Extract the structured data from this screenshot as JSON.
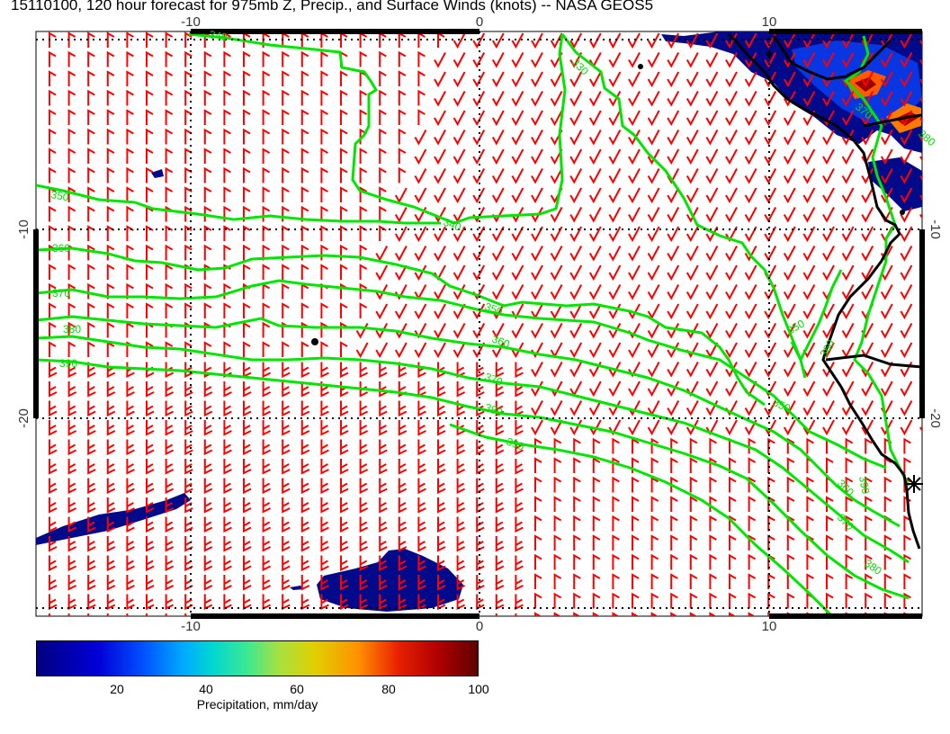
{
  "title": "15110100, 120 hour forecast for 975mb Z, Precip., and Surface Winds (knots) -- NASA GEOS5",
  "map": {
    "lon_ticks": [
      "-10",
      "0",
      "10"
    ],
    "lat_ticks": [
      "-10",
      "-20"
    ],
    "contour_labels": [
      "340",
      "350",
      "360",
      "370",
      "380",
      "390",
      "340",
      "350",
      "360",
      "370",
      "380",
      "390",
      "350",
      "360",
      "370",
      "380",
      "390",
      "330",
      "350",
      "360",
      "370",
      "380"
    ],
    "colors": {
      "contour": "#00e600",
      "wind_barb": "#ff0000",
      "coastline": "#000000",
      "precip_low": "#000080"
    },
    "station_marker": "asterisk"
  },
  "colorbar": {
    "ticks": [
      "20",
      "40",
      "60",
      "80",
      "100"
    ],
    "label": "Precipitation, mm/day"
  }
}
